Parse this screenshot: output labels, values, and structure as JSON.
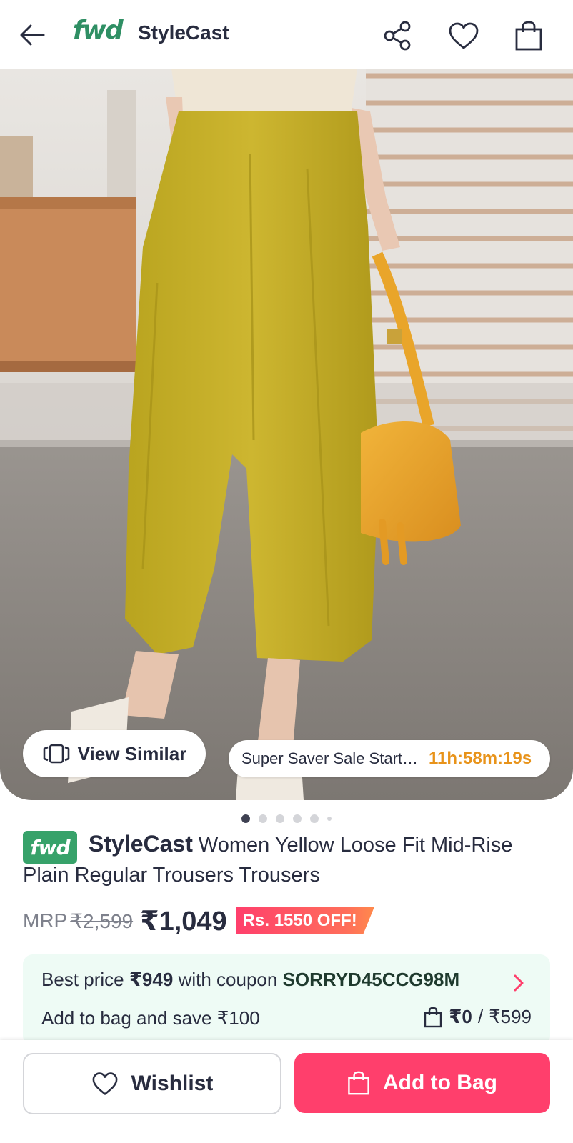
{
  "header": {
    "logo_text": "fwd",
    "title": "StyleCast",
    "icons": [
      "back-arrow-icon",
      "share-icon",
      "heart-icon",
      "shopping-bag-icon"
    ]
  },
  "hero": {
    "view_similar_label": "View Similar",
    "sale_text": "Super Saver Sale Starts in",
    "sale_timer": "11h:58m:19s",
    "carousel": {
      "count": 6,
      "active_index": 0
    }
  },
  "product": {
    "badge_text": "fwd",
    "brand": "StyleCast",
    "name": "Women Yellow Loose Fit Mid-Rise Plain Regular Trousers Trousers",
    "mrp_label": "MRP",
    "mrp_value": "₹2,599",
    "price": "₹1,049",
    "discount_label": "Rs. 1550 OFF!"
  },
  "coupon": {
    "prefix": "Best price",
    "best_price": "₹949",
    "middle": "with coupon",
    "code": "SORRYD45CCG98M",
    "save_text": "Add to bag and save ₹100",
    "bag_current": "₹0",
    "bag_separator": "/",
    "bag_target": "₹599"
  },
  "actions": {
    "wishlist_label": "Wishlist",
    "add_to_bag_label": "Add to Bag"
  },
  "colors": {
    "accent": "#ff3f6c",
    "brand_green": "#2f8f64",
    "timer_orange": "#e8931a",
    "coupon_bg": "#eefbf5"
  }
}
